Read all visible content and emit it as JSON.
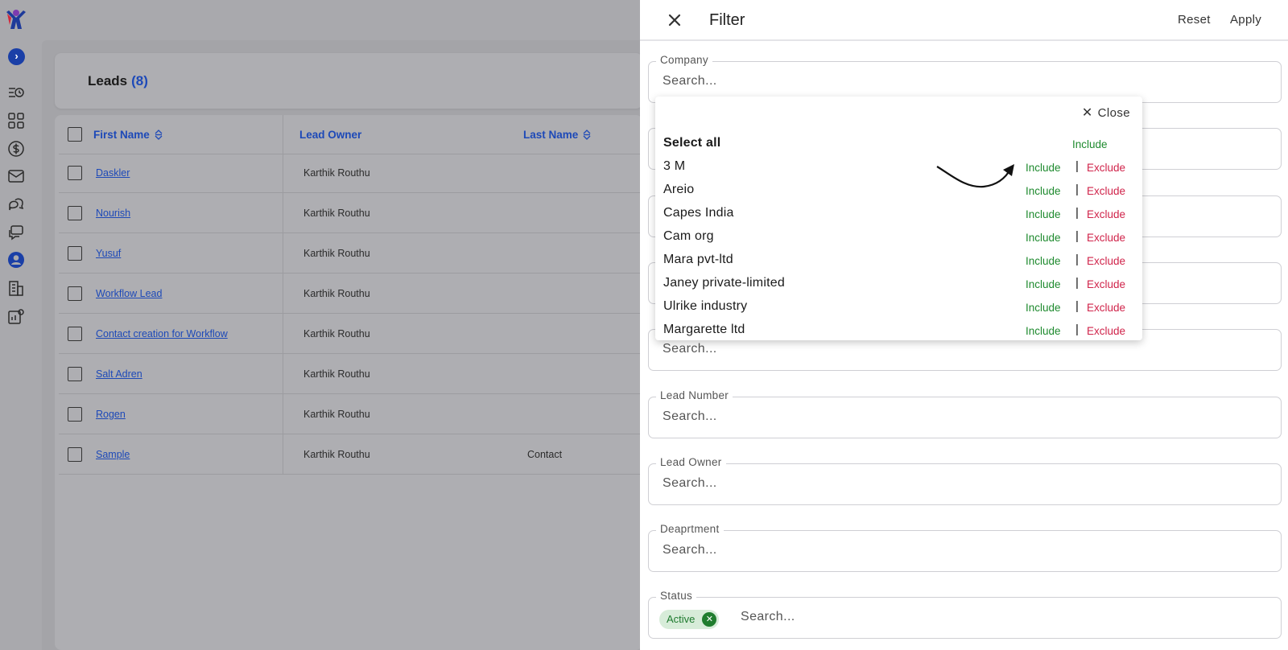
{
  "leads": {
    "title": "Leads",
    "count": "(8)"
  },
  "table": {
    "columns": [
      "First Name",
      "Lead Owner",
      "Last Name"
    ],
    "rows": [
      {
        "first_name": "Daskler",
        "lead_owner": "Karthik Routhu",
        "last_name": ""
      },
      {
        "first_name": "Nourish",
        "lead_owner": "Karthik Routhu",
        "last_name": ""
      },
      {
        "first_name": "Yusuf",
        "lead_owner": "Karthik Routhu",
        "last_name": ""
      },
      {
        "first_name": "Workflow Lead",
        "lead_owner": "Karthik Routhu",
        "last_name": ""
      },
      {
        "first_name": "Contact creation for Workflow",
        "lead_owner": "Karthik Routhu",
        "last_name": ""
      },
      {
        "first_name": "Salt Adren",
        "lead_owner": "Karthik Routhu",
        "last_name": ""
      },
      {
        "first_name": "Rogen",
        "lead_owner": "Karthik Routhu",
        "last_name": ""
      },
      {
        "first_name": "Sample",
        "lead_owner": "Karthik Routhu",
        "last_name": "Contact"
      }
    ]
  },
  "filter": {
    "title": "Filter",
    "reset_label": "Reset",
    "apply_label": "Apply",
    "fields": [
      {
        "label": "Company",
        "placeholder": "Search..."
      },
      {
        "label": "",
        "placeholder": "Search..."
      },
      {
        "label": "Lead Number",
        "placeholder": "Search..."
      },
      {
        "label": "Lead Owner",
        "placeholder": "Search..."
      },
      {
        "label": "Deaprtment",
        "placeholder": "Search..."
      },
      {
        "label": "Status",
        "placeholder": "Search...",
        "chip": "Active"
      }
    ]
  },
  "dropdown": {
    "close_label": "Close",
    "select_all_label": "Select all",
    "include_label": "Include",
    "exclude_label": "Exclude",
    "separator": "|",
    "options": [
      "3 M",
      "Areio",
      "Capes India",
      "Cam org",
      "Mara pvt-ltd",
      "Janey private-limited",
      "Ulrike industry",
      "Margarette ltd"
    ]
  },
  "colors": {
    "accent_blue": "#1d49b8",
    "include_green": "#1e8a2e",
    "exclude_red": "#d0234a",
    "chip_bg": "#d7ecd9"
  },
  "icons": {
    "sidebar": [
      "list-clock-icon",
      "grid-icon",
      "dollar-icon",
      "mail-icon",
      "chat-icon",
      "message-icon",
      "user-icon",
      "building-icon",
      "settings-chart-icon"
    ]
  }
}
